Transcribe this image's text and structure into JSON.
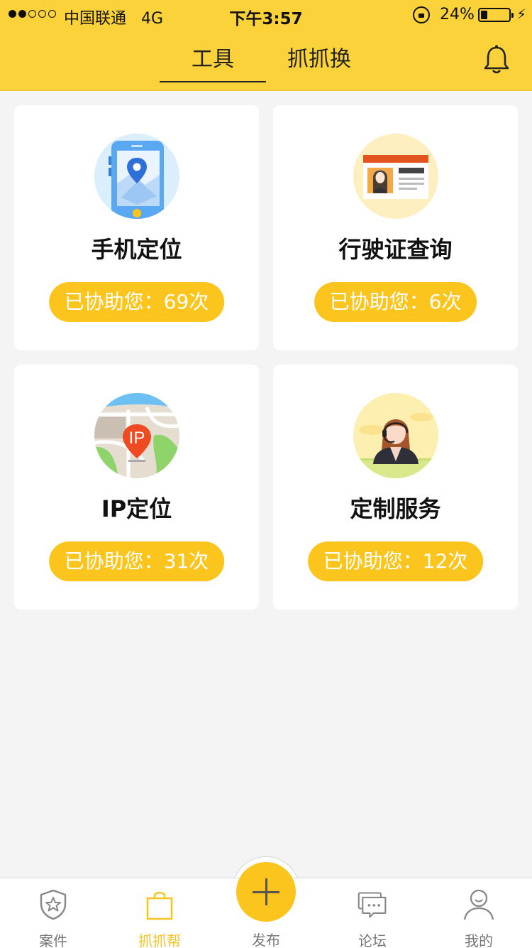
{
  "status_bar": {
    "carrier": "中国联通",
    "network": "4G",
    "time": "下午3:57",
    "battery_percent": "24%",
    "battery_level": 0.24,
    "signal_bars_filled": 2,
    "signal_bars_total": 5
  },
  "header": {
    "tabs": [
      {
        "label": "工具",
        "active": true
      },
      {
        "label": "抓抓换",
        "active": false
      }
    ],
    "notification_icon": "bell-icon"
  },
  "tools": [
    {
      "title": "手机定位",
      "badge": "已协助您：69次",
      "icon": "phone-location-icon"
    },
    {
      "title": "行驶证查询",
      "badge": "已协助您：6次",
      "icon": "license-card-icon"
    },
    {
      "title": "IP定位",
      "badge": "已协助您：31次",
      "icon": "ip-map-icon"
    },
    {
      "title": "定制服务",
      "badge": "已协助您：12次",
      "icon": "customer-service-icon"
    }
  ],
  "tabbar": {
    "items": [
      {
        "label": "案件",
        "icon": "shield-star-icon",
        "active": false
      },
      {
        "label": "抓抓帮",
        "icon": "shopping-bag-icon",
        "active": true
      },
      {
        "label": "发布",
        "icon": "plus-icon",
        "active": false
      },
      {
        "label": "论坛",
        "icon": "chat-bubbles-icon",
        "active": false
      },
      {
        "label": "我的",
        "icon": "user-icon",
        "active": false
      }
    ]
  },
  "colors": {
    "brand_yellow": "#fcd23a",
    "badge_yellow": "#fbc51e",
    "active_tab_label": "#f7c325"
  }
}
